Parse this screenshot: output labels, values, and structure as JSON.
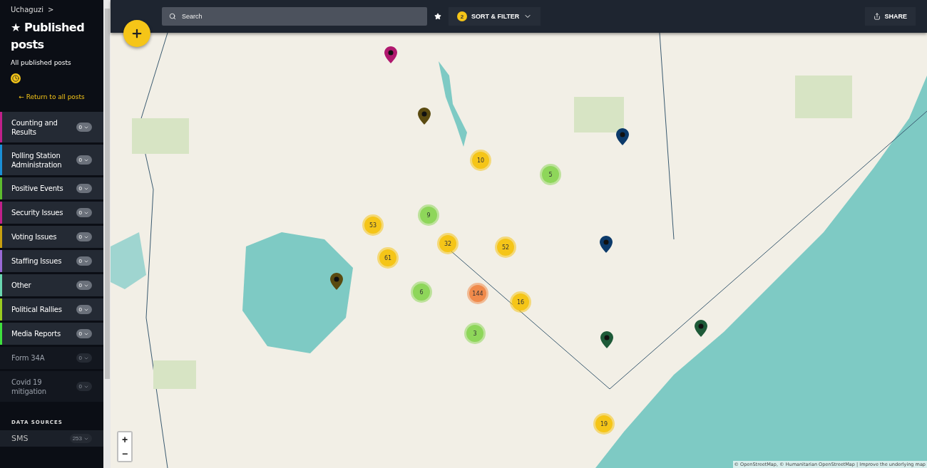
{
  "sidebar": {
    "breadcrumb": "Uchaguzi",
    "breadcrumb_separator": ">",
    "title": "★ Published posts",
    "subtitle": "All published posts",
    "return_link": "← Return to all posts",
    "categories": [
      {
        "label": "Counting and Results",
        "count": "0",
        "color": "#c0208a",
        "enabled": true
      },
      {
        "label": "Polling Station Administration",
        "count": "0",
        "color": "#1a8fd6",
        "enabled": true
      },
      {
        "label": "Positive Events",
        "count": "0",
        "color": "#5dbb2e",
        "enabled": true
      },
      {
        "label": "Security Issues",
        "count": "0",
        "color": "#c0208a",
        "enabled": true
      },
      {
        "label": "Voting Issues",
        "count": "0",
        "color": "#c8a010",
        "enabled": true
      },
      {
        "label": "Staffing Issues",
        "count": "0",
        "color": "#9a6ad6",
        "enabled": true
      },
      {
        "label": "Other",
        "count": "0",
        "color": "#6ad6b0",
        "enabled": true
      },
      {
        "label": "Political Rallies",
        "count": "0",
        "color": "#9acb20",
        "enabled": true
      },
      {
        "label": "Media Reports",
        "count": "0",
        "color": "#3ee03e",
        "enabled": true
      },
      {
        "label": "Form 34A",
        "count": "0",
        "enabled": false
      },
      {
        "label": "Covid 19 mitigation",
        "count": "0",
        "enabled": false
      }
    ],
    "data_sources_heading": "DATA SOURCES",
    "data_sources": [
      {
        "label": "SMS",
        "count": "253"
      }
    ]
  },
  "toolbar": {
    "search": {
      "placeholder": "Search"
    },
    "filter_count": "2",
    "filter_label": "SORT & FILTER",
    "share_label": "SHARE"
  },
  "map": {
    "clusters": [
      {
        "label": "10",
        "color": "#f5c518"
      },
      {
        "label": "5",
        "color": "#8ed65a"
      },
      {
        "label": "9",
        "color": "#8ed65a"
      },
      {
        "label": "53",
        "color": "#f5c518"
      },
      {
        "label": "32",
        "color": "#f5c518"
      },
      {
        "label": "52",
        "color": "#f5c518"
      },
      {
        "label": "61",
        "color": "#f5c518"
      },
      {
        "label": "6",
        "color": "#8ed65a"
      },
      {
        "label": "144",
        "color": "#f08a4b"
      },
      {
        "label": "16",
        "color": "#f5c518"
      },
      {
        "label": "3",
        "color": "#8ed65a"
      },
      {
        "label": "19",
        "color": "#f5c518"
      }
    ],
    "pins": [
      {
        "color": "#b0186e"
      },
      {
        "color": "#5a4a10"
      },
      {
        "color": "#0c3a6a"
      },
      {
        "color": "#0c3a6a"
      },
      {
        "color": "#5a4a10"
      },
      {
        "color": "#1e5a38"
      },
      {
        "color": "#1e5a38"
      }
    ],
    "zoom_in": "+",
    "zoom_out": "−",
    "attribution": "© OpenStreetMap, © Humanitarian OpenStreetMap | Improve the underlying map"
  }
}
